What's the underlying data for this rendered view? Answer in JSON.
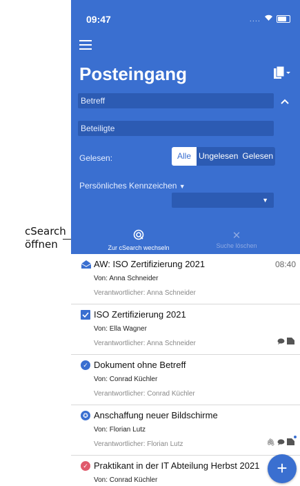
{
  "annotation": {
    "line1": "cSearch",
    "line2": "öffnen"
  },
  "status_bar": {
    "time": "09:47",
    "signal": "....",
    "wifi": "wifi-icon",
    "battery": "battery-icon"
  },
  "header": {
    "title": "Posteingang",
    "subject_filter": "Betreff",
    "participants_filter": "Beteiligte",
    "read_label": "Gelesen:",
    "read_options": [
      "Alle",
      "Ungelesen",
      "Gelesen"
    ],
    "read_selected": "Alle",
    "personal_mark_label": "Persönliches Kennzeichen",
    "personal_mark_value": ""
  },
  "actions": {
    "csearch_label": "Zur cSearch wechseln",
    "clear_label": "Suche löschen"
  },
  "messages": [
    {
      "subject": "AW: ISO Zertifizierung 2021",
      "time": "08:40",
      "from": "Von: Anna Schneider",
      "responsible": "Verantwortlicher: Anna Schneider",
      "icon": "envelope-open-icon"
    },
    {
      "subject": "ISO Zertifizierung 2021",
      "from": "Von: Ella Wagner",
      "responsible": "Verantwortlicher: Anna Schneider",
      "icon": "checkbox-icon"
    },
    {
      "subject": "Dokument ohne Betreff",
      "from": "Von: Conrad Küchler",
      "responsible": "Verantwortlicher: Conrad Küchler",
      "icon": "check-circle-icon"
    },
    {
      "subject": "Anschaffung neuer Bildschirme",
      "from": "Von: Florian Lutz",
      "responsible": "Verantwortlicher: Florian Lutz",
      "icon": "award-icon"
    },
    {
      "subject": "Praktikant in der IT Abteilung Herbst 2021",
      "from": "Von: Conrad Küchler",
      "responsible": "",
      "icon": "check-circle-red-icon"
    }
  ],
  "colors": {
    "primary": "#3a6fd0",
    "field": "#2c5bb3",
    "check_blue": "#3a6fd0",
    "check_red": "#e05a6c"
  }
}
